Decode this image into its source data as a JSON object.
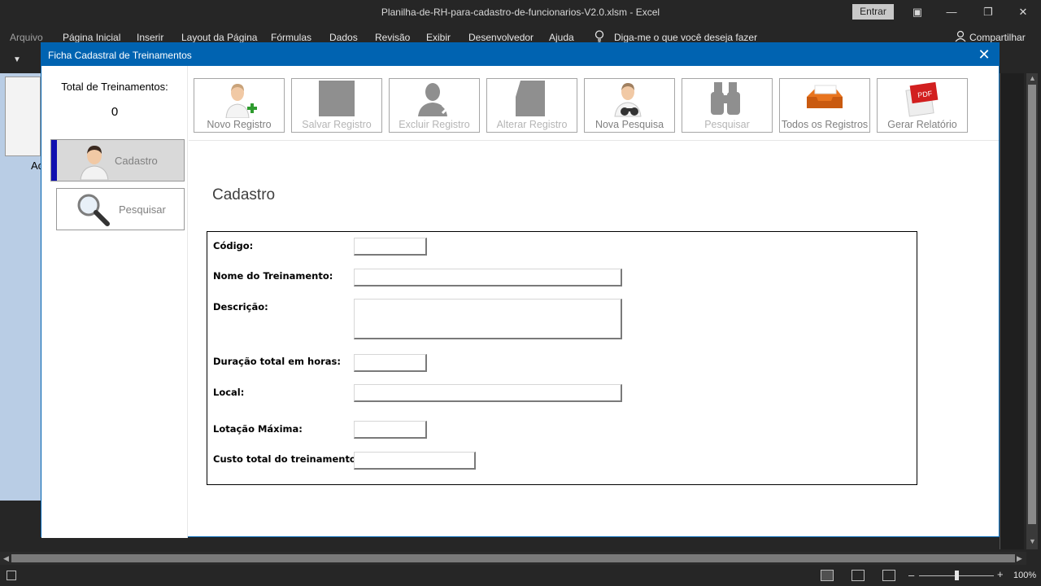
{
  "window": {
    "title": "Planilha-de-RH-para-cadastro-de-funcionarios-V2.0.xlsm  -  Excel",
    "signin_label": "Entrar"
  },
  "ribbon": {
    "tabs": [
      "Arquivo",
      "Página Inicial",
      "Inserir",
      "Layout da Página",
      "Fórmulas",
      "Dados",
      "Revisão",
      "Exibir",
      "Desenvolvedor",
      "Ajuda"
    ],
    "tell_me": "Diga-me o que você deseja fazer",
    "share": "Compartilhar"
  },
  "background": {
    "cell_text": "Ac"
  },
  "dialog": {
    "title": "Ficha Cadastral de Treinamentos",
    "total_label": "Total de Treinamentos:",
    "total_value": "0",
    "nav": {
      "cadastro": "Cadastro",
      "pesquisar": "Pesquisar"
    },
    "toolbar": {
      "novo_registro": "Novo Registro",
      "salvar_registro": "Salvar Registro",
      "excluir_registro": "Excluir Registro",
      "alterar_registro": "Alterar Registro",
      "nova_pesquisa": "Nova Pesquisa",
      "pesquisar": "Pesquisar",
      "todos_registros": "Todos os Registros",
      "gerar_relatorio": "Gerar Relatório"
    },
    "section_title": "Cadastro",
    "form": {
      "codigo": {
        "label": "Código:",
        "value": ""
      },
      "nome": {
        "label": "Nome do Treinamento:",
        "value": ""
      },
      "descricao": {
        "label": "Descrição:",
        "value": ""
      },
      "duracao": {
        "label": "Duração total em horas:",
        "value": ""
      },
      "local": {
        "label": "Local:",
        "value": ""
      },
      "lotacao": {
        "label": "Lotação Máxima:",
        "value": ""
      },
      "custo": {
        "label": "Custo total do treinamento:",
        "value": ""
      }
    },
    "pdf_icon_text": "PDF"
  },
  "statusbar": {
    "zoom": "100%"
  },
  "colors": {
    "dialog_accent": "#0063b1",
    "nav_active_bar": "#1010b0",
    "add_green": "#2e9b2e"
  }
}
